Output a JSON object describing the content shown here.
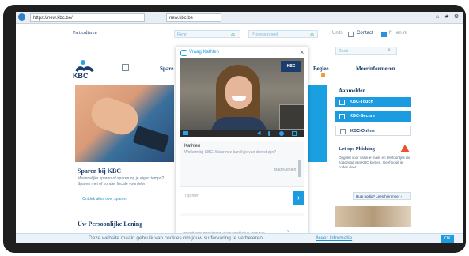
{
  "browser": {
    "address_url": "https://new.kbc.be/",
    "tab_title": "new.kbc.be"
  },
  "top": {
    "segment": "Particulieren",
    "field1": "Renn",
    "field2": "Professioneel",
    "lang": "Units",
    "contact": "Contact",
    "langs": [
      "nl",
      "fr",
      "en"
    ]
  },
  "header": {
    "logo_text": "KBC",
    "nav1": "Spare",
    "nav2": "Beglee",
    "nav3": "Meerinformeren",
    "search_placeholder": "Zoek"
  },
  "main": {
    "section1_title": "Sparen bij KBC",
    "section1_text": "Maandelijks sparen of sparen op je eigen tempo? Sparen met of zonder fiscale voordelen",
    "section1_link": "Ontdek alles over sparen",
    "section2_title": "Uw Persoonlijke Lening"
  },
  "chat": {
    "title": "Vraag Kathlen",
    "close": "×",
    "agent_name": "Kathlen",
    "agent_message": "Welkom bij KBC. Waarmee kan ik je van dienst zijn?",
    "meta": "Bag Kathlen",
    "input_placeholder": "Typ hier",
    "footer_link": "gebruiksvoorwaarden en privacyverklaring · wat KBC",
    "send_label": "›",
    "video_badge": "KBC"
  },
  "sidebar": {
    "title": "Aanmelden",
    "buttons": [
      {
        "label": "KBC-Touch",
        "state": "on"
      },
      {
        "label": "KBC-Secure",
        "state": "on"
      },
      {
        "label": "KBC-Online",
        "state": "off"
      }
    ],
    "alert_title": "Let op: Phishing",
    "alert_text": "Opgelet voor valse e-mails en telefoontjes die zogezegd van KBC komen. Geef nooit je codes door.",
    "help_button": "Hulp nodig? Lees hier meer ›"
  },
  "cookie": {
    "text": "Deze website maakt gebruik van cookies om jouw surfervaring te verbeteren.",
    "link": "Meer informatie",
    "ok": "OK"
  },
  "colors": {
    "brand_dark": "#1a3d6d",
    "accent": "#1b9be0",
    "alert": "#e8522e"
  }
}
